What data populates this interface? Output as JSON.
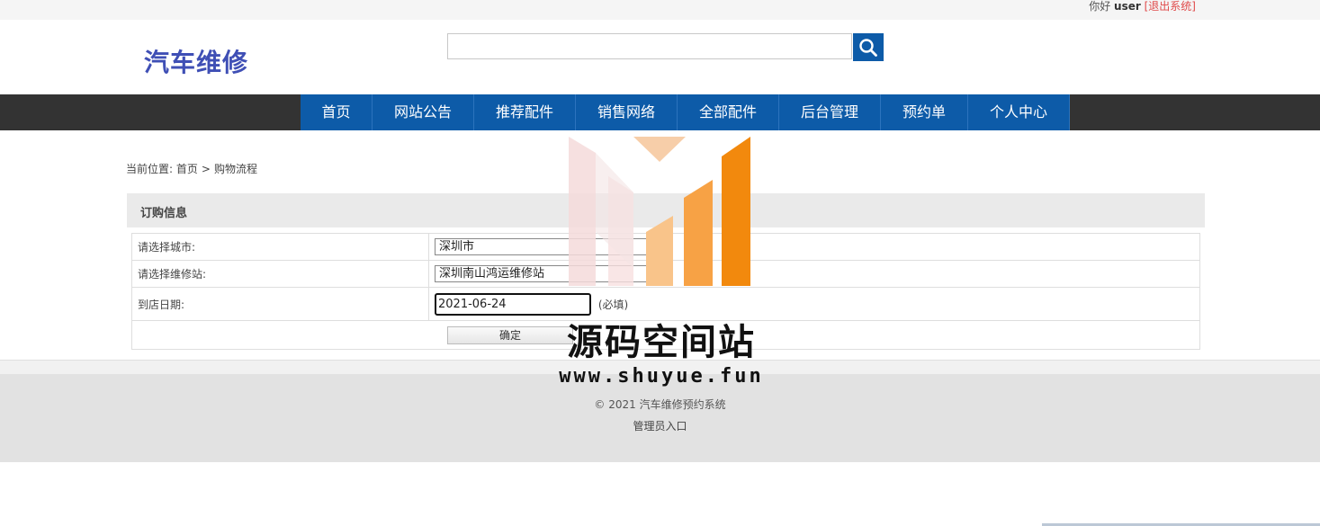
{
  "topbar": {
    "greeting": "你好",
    "username": "user",
    "logout": "[退出系统]"
  },
  "header": {
    "logo": "汽车维修",
    "search_placeholder": "",
    "search_icon": "search-icon"
  },
  "nav": {
    "items": [
      "首页",
      "网站公告",
      "推荐配件",
      "销售网络",
      "全部配件",
      "后台管理",
      "预约单",
      "个人中心"
    ]
  },
  "breadcrumb": {
    "prefix": "当前位置:",
    "home": "首页",
    "separator": ">",
    "current": "购物流程"
  },
  "panel": {
    "title": "订购信息"
  },
  "form": {
    "city_label": "请选择城市:",
    "city_value": "深圳市",
    "station_label": "请选择维修站:",
    "station_value": "深圳南山鸿运维修站",
    "date_label": "到店日期:",
    "date_value": "2021-06-24",
    "date_note": "(必填)",
    "confirm_label": "确定"
  },
  "footer": {
    "copyright": "© 2021 汽车维修预约系统",
    "admin_link": "管理员入口"
  },
  "watermark": {
    "title": "源码空间站",
    "url": "www.shuyue.fun"
  },
  "colors": {
    "brand_blue": "#0d5ba8",
    "logo_blue": "#3f4fb5",
    "nav_bg": "#333333",
    "logout_red": "#e04b4b"
  }
}
